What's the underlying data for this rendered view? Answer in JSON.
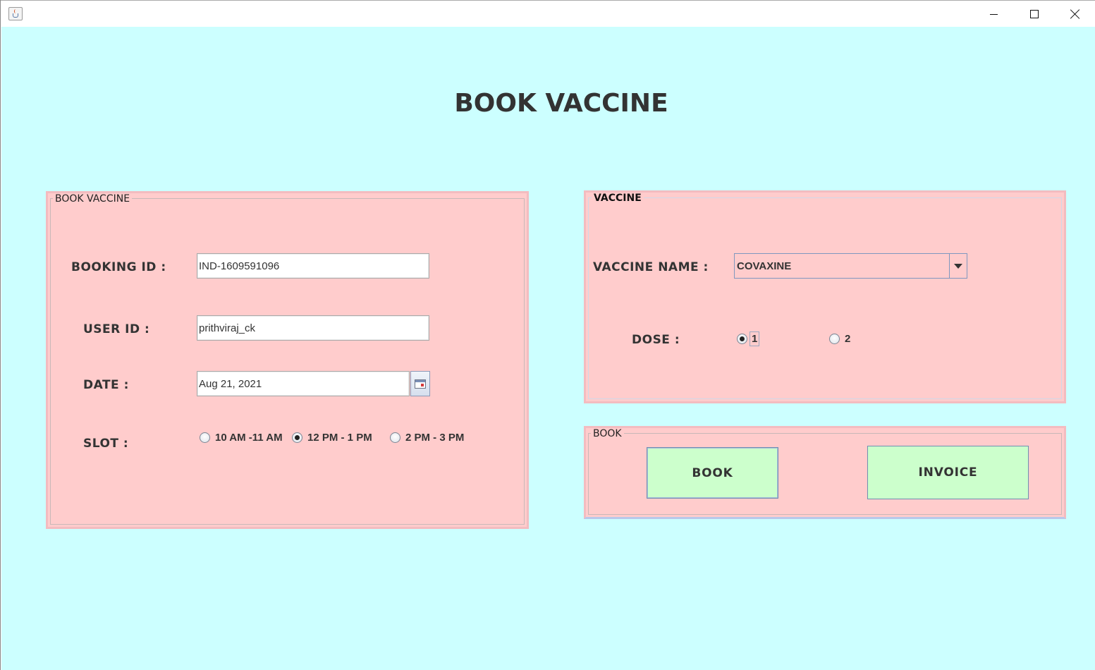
{
  "window": {
    "title": "",
    "app_icon": "java-cup-icon",
    "controls": {
      "minimize": "minimize-icon",
      "maximize": "maximize-icon",
      "close": "close-icon"
    }
  },
  "colors": {
    "background": "#ccffff",
    "panel": "#ffcccc",
    "button": "#ccffcc",
    "text": "#333333"
  },
  "page": {
    "title": "BOOK VACCINE"
  },
  "booking_panel": {
    "title": "BOOK VACCINE",
    "booking_id": {
      "label": "BOOKING ID :",
      "value": "IND-1609591096"
    },
    "user_id": {
      "label": "USER ID :",
      "value": "prithviraj_ck"
    },
    "date": {
      "label": "DATE :",
      "value": "Aug 21, 2021",
      "picker_icon": "calendar-icon"
    },
    "slot": {
      "label": "SLOT :",
      "options": [
        {
          "label": "10 AM -11 AM",
          "selected": false
        },
        {
          "label": "12 PM - 1 PM",
          "selected": true
        },
        {
          "label": "2 PM - 3 PM",
          "selected": false
        }
      ]
    }
  },
  "vaccine_panel": {
    "title": "VACCINE",
    "vaccine_name": {
      "label": "VACCINE NAME :",
      "selected": "COVAXINE"
    },
    "dose": {
      "label": "DOSE :",
      "options": [
        {
          "label": "1",
          "selected": true
        },
        {
          "label": "2",
          "selected": false
        }
      ]
    }
  },
  "book_panel": {
    "title": "BOOK",
    "book_button": "BOOK",
    "invoice_button": "INVOICE"
  }
}
